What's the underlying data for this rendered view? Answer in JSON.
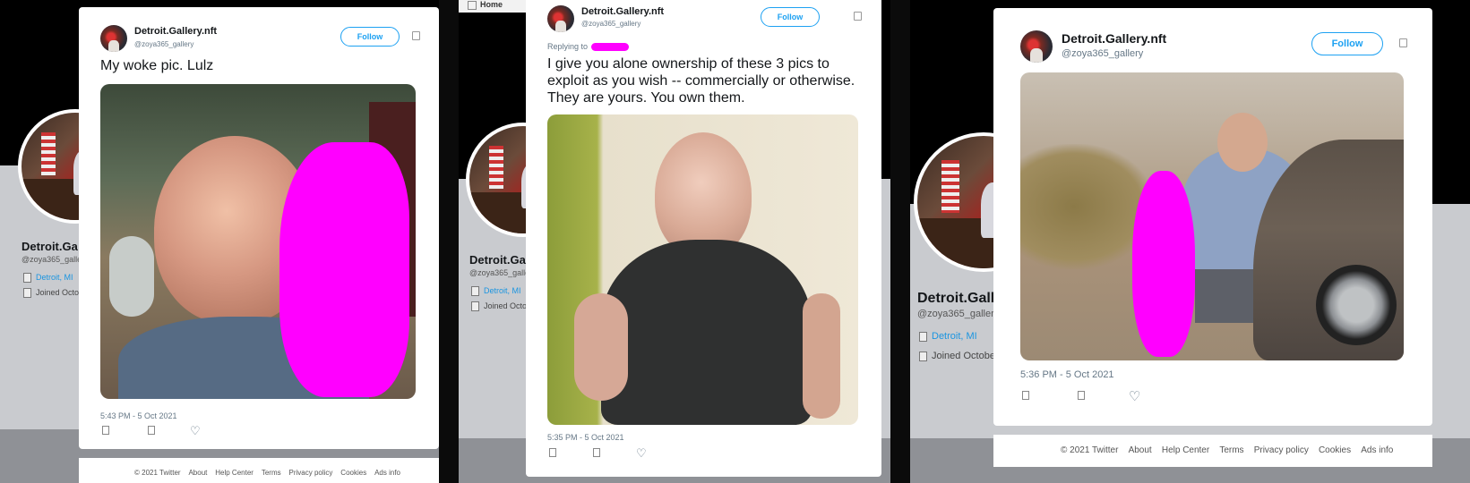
{
  "colors": {
    "accent": "#1da1f2",
    "redaction": "#ff00ff",
    "link": "#1b95e0"
  },
  "profile": {
    "name_partial": "Detroit.Ga",
    "name_partial_3": "Detroit.Gall",
    "handle_partial": "@zoya365_galle",
    "handle_partial_2": "@zoya365_galle",
    "handle_partial_3": "@zoya365_gallery",
    "location": "Detroit, MI",
    "joined_partial": "Joined Octob",
    "joined_partial_2": "Joined Octob",
    "joined_partial_3": "Joined Octobe"
  },
  "nav": {
    "home": "Home",
    "icon": "home-icon"
  },
  "tweets": [
    {
      "name": "Detroit.Gallery.nft",
      "handle": "@zoya365_gallery",
      "follow": "Follow",
      "text": "My woke pic. Lulz",
      "timestamp": "5:43 PM - 5 Oct 2021"
    },
    {
      "name": "Detroit.Gallery.nft",
      "handle": "@zoya365_gallery",
      "follow": "Follow",
      "replying_to": "Replying to",
      "text": "I give you alone ownership of these 3 pics to exploit as you wish -- commercially or otherwise. They are yours. You own them.",
      "timestamp": "5:35 PM - 5 Oct 2021"
    },
    {
      "name": "Detroit.Gallery.nft",
      "handle": "@zoya365_gallery",
      "follow": "Follow",
      "timestamp": "5:36 PM - 5 Oct 2021"
    }
  ],
  "footer": [
    "© 2021 Twitter",
    "About",
    "Help Center",
    "Terms",
    "Privacy policy",
    "Cookies",
    "Ads info"
  ]
}
